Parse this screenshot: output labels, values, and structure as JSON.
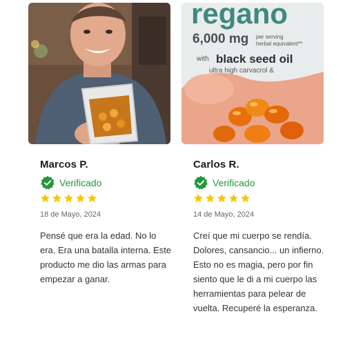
{
  "reviews": [
    {
      "photo": "man-holding-capsule-pouch",
      "name": "Marcos P.",
      "verified_label": "Verificado",
      "rating": 5,
      "date": "18 de Mayo, 2024",
      "text": "Pensé que era la edad. No lo era. Era una batalla interna. Este producto me dio las armas para empezar a ganar."
    },
    {
      "photo": "hand-holding-oregano-softgels",
      "name": "Carlos R.",
      "verified_label": "Verificado",
      "rating": 5,
      "date": "14 de Mayo, 2024",
      "text": "Creí que mi cuerpo se rendía. Dolores, cansancio... un infierno. Esto no es magia, pero por fin siento que le di a mi cuerpo las herramientas para pelear de vuelta. Recuperé la esperanza."
    }
  ],
  "package_label": {
    "brand_fragment": "regano",
    "dose": "6,000 mg",
    "dose_note_1": "per serving",
    "dose_note_2": "herbal equivalent**",
    "ingredient_prefix": "with",
    "ingredient": "black seed oil",
    "detail_1": "ultra high carvacrol &",
    "detail_2": "none"
  },
  "colors": {
    "verified_green": "#1f9a3a",
    "star_yellow": "#f7c600",
    "package_teal": "#3f8a7e"
  },
  "icons": {
    "verified": "verified-badge-icon",
    "star": "star-icon"
  }
}
